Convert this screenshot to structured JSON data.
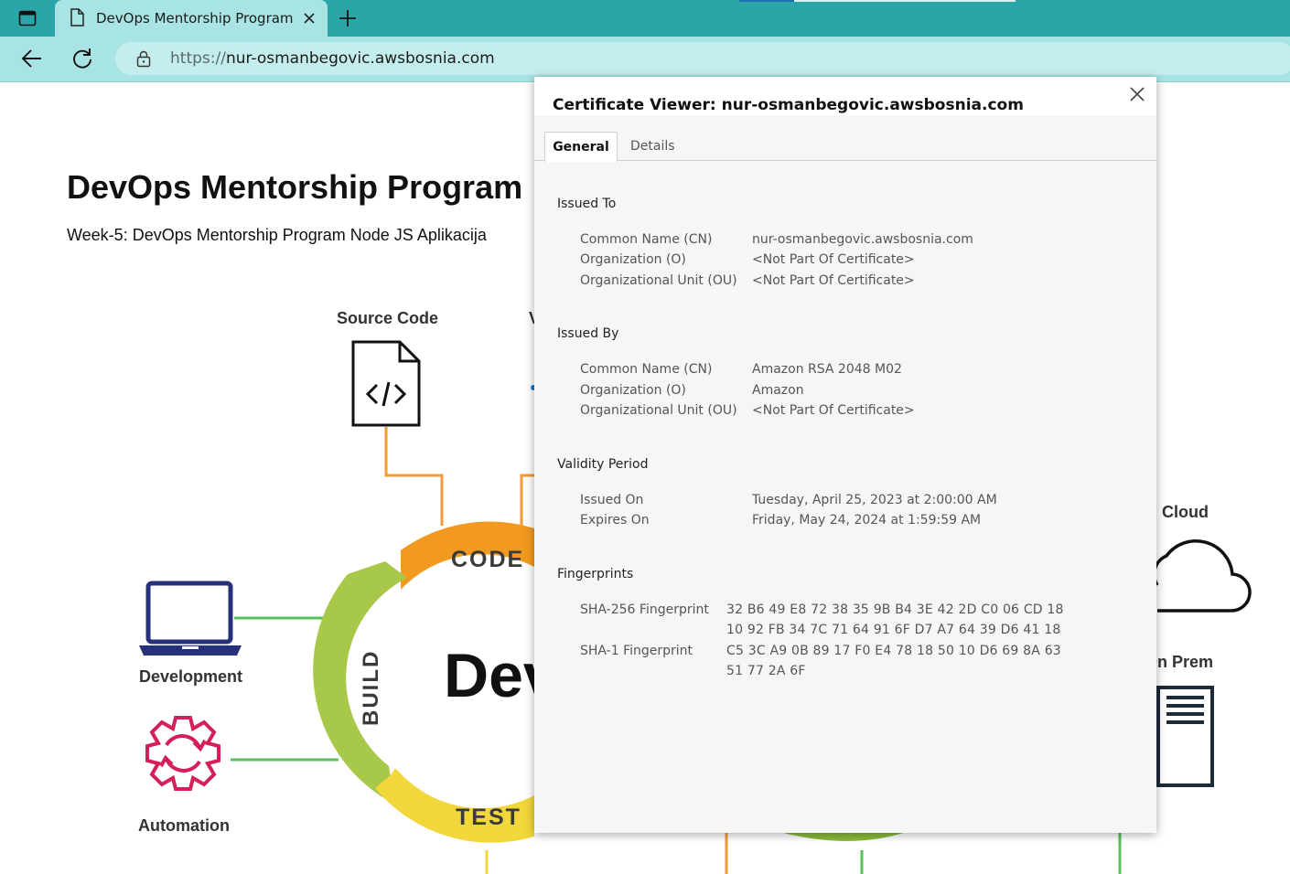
{
  "browser": {
    "tab_title": "DevOps Mentorship Program",
    "url_scheme": "https://",
    "url_host": "nur-osmanbegovic.awsbosnia.com",
    "colors": {
      "tabbar": "#2aa5a8",
      "toolbar": "#a7e4e3"
    },
    "icons": [
      "window-menu-icon",
      "page-icon",
      "close-icon",
      "plus-icon",
      "back-arrow-icon",
      "refresh-icon",
      "lock-icon"
    ]
  },
  "page": {
    "title": "DevOps Mentorship Program",
    "subtitle": "Week-5: DevOps Mentorship Program Node JS Aplikacija",
    "diagram": {
      "source_code": "Source Code",
      "partial_label": "V",
      "development": "Development",
      "automation": "Automation",
      "cloud": "Cloud",
      "on_prem": "On Prem",
      "code": "CODE",
      "build": "BUILD",
      "test": "TEST",
      "center_text": "Dev"
    }
  },
  "cert": {
    "title": "Certificate Viewer: nur-osmanbegovic.awsbosnia.com",
    "tabs": {
      "general": "General",
      "details": "Details"
    },
    "issued_to": {
      "heading": "Issued To",
      "cn_label": "Common Name (CN)",
      "cn_value": "nur-osmanbegovic.awsbosnia.com",
      "o_label": "Organization (O)",
      "o_value": "<Not Part Of Certificate>",
      "ou_label": "Organizational Unit (OU)",
      "ou_value": "<Not Part Of Certificate>"
    },
    "issued_by": {
      "heading": "Issued By",
      "cn_label": "Common Name (CN)",
      "cn_value": "Amazon RSA 2048 M02",
      "o_label": "Organization (O)",
      "o_value": "Amazon",
      "ou_label": "Organizational Unit (OU)",
      "ou_value": "<Not Part Of Certificate>"
    },
    "validity": {
      "heading": "Validity Period",
      "issued_on_label": "Issued On",
      "issued_on_value": "Tuesday, April 25, 2023 at 2:00:00 AM",
      "expires_on_label": "Expires On",
      "expires_on_value": "Friday, May 24, 2024 at 1:59:59 AM"
    },
    "fingerprints": {
      "heading": "Fingerprints",
      "sha256_label": "SHA-256 Fingerprint",
      "sha256_line1": "32 B6 49 E8 72 38 35 9B B4 3E 42 2D C0 06 CD 18",
      "sha256_line2": "10 92 FB 34 7C 71 64 91 6F D7 A7 64 39 D6 41 18",
      "sha1_label": "SHA-1 Fingerprint",
      "sha1_line1": "C5 3C A9 0B 89 17 F0 E4 78 18 50 10 D6 69 8A 63",
      "sha1_line2": "51 77 2A 6F"
    }
  }
}
